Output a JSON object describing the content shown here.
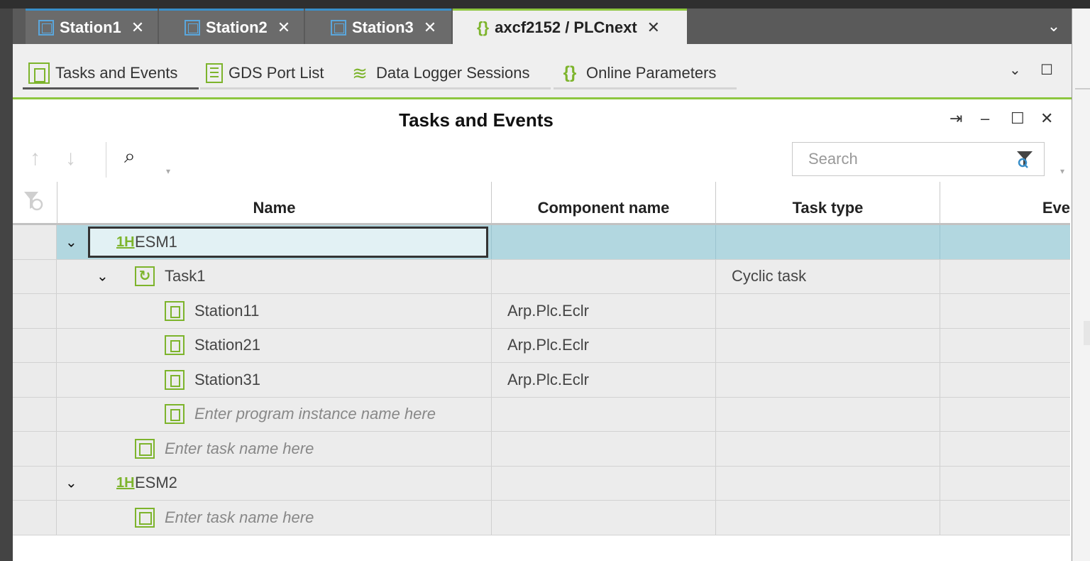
{
  "doc_tabs": [
    {
      "label": "Station1",
      "close": "✕"
    },
    {
      "label": "Station2",
      "close": "✕"
    },
    {
      "label": "Station3",
      "close": "✕"
    },
    {
      "label": "axcf2152 / PLCnext",
      "close": "✕"
    }
  ],
  "doc_overflow": "⌄",
  "tool_tabs": [
    {
      "label": "Tasks and Events"
    },
    {
      "label": "GDS Port List"
    },
    {
      "label": "Data Logger Sessions"
    },
    {
      "label": "Online Parameters"
    }
  ],
  "panel": {
    "title": "Tasks and Events",
    "search_placeholder": "Search"
  },
  "grid": {
    "columns": {
      "name": "Name",
      "component": "Component name",
      "task_type": "Task type",
      "events": "Eve"
    },
    "rows": [
      {
        "name": "ESM1",
        "component": "",
        "task_type": ""
      },
      {
        "name": "Task1",
        "component": "",
        "task_type": "Cyclic task"
      },
      {
        "name": "Station11",
        "component": "Arp.Plc.Eclr",
        "task_type": ""
      },
      {
        "name": "Station21",
        "component": "Arp.Plc.Eclr",
        "task_type": ""
      },
      {
        "name": "Station31",
        "component": "Arp.Plc.Eclr",
        "task_type": ""
      },
      {
        "name": "Enter program instance name here",
        "component": "",
        "task_type": ""
      },
      {
        "name": "Enter task name here",
        "component": "",
        "task_type": ""
      },
      {
        "name": "ESM2",
        "component": "",
        "task_type": ""
      },
      {
        "name": "Enter task name here",
        "component": "",
        "task_type": ""
      }
    ]
  },
  "colors": {
    "accent_green": "#8dc63f",
    "accent_blue": "#3a8fc9",
    "selection": "#b2d7e0"
  }
}
